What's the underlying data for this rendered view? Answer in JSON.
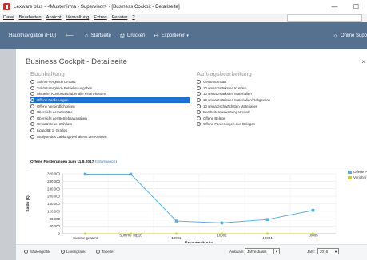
{
  "window": {
    "title": "Lexware plus - <Musterfirma - Supervisor> - [Business Cockpit - Detailseite]",
    "controls": [
      "—",
      "☐"
    ]
  },
  "menu": {
    "items": [
      "Datei",
      "Bearbeiten",
      "Ansicht",
      "Verwaltung",
      "Extras",
      "Fenster",
      "?"
    ]
  },
  "toolbar": {
    "hauptnavigation": "Hauptnavigation (F10)",
    "startseite": "Startseite",
    "drucken": "Drucken",
    "exportieren": "Exportieren",
    "online": "Online Supp"
  },
  "page": {
    "title": "Business Cockpit - Detailseite",
    "close": "×"
  },
  "buchhaltung": {
    "heading": "Buchhaltung",
    "selected_index": 3,
    "items": [
      "Soll/Ist-Vergleich Umsatz",
      "Soll/Ist-Vergleich Betriebsausgaben",
      "Aktueller Kontostand über alle Finanzkonten",
      "Offene Forderungen",
      "Offene Verbindlichkeiten",
      "Übersicht der Umsätze",
      "Übersicht der Betriebsausgaben",
      "Umsatzsteuer Zahllast",
      "Liquidität 1. Grades",
      "Analyse des Zahlungsverhaltens der Kunden"
    ]
  },
  "auftrag": {
    "heading": "Auftragsbearbeitung",
    "items": [
      "Gesamtumsatz",
      "10 umsatzstärksten Kunden",
      "10 umsatzstärksten Materialien",
      "10 umsatzstärksten Materialien/Rohgewinn",
      "10 umsatzschwächsten Materialien",
      "Bearbeiterauswertung Umsatz",
      "Offene Belege",
      "Offene Forderungen aus Belegen"
    ]
  },
  "chart_header": {
    "title": "Offene Forderungen zum 11.8.2017",
    "info": "(Information)"
  },
  "chart_data": {
    "type": "line",
    "ylabel": "Saldo (€)",
    "xlabel": "Personenkonto",
    "ylim": [
      0,
      320000
    ],
    "yticks": [
      0,
      40000,
      80000,
      120000,
      160000,
      200000,
      240000,
      280000,
      320000
    ],
    "ytick_labels": [
      "0",
      "40.000",
      "80.000",
      "120.000",
      "160.000",
      "200.000",
      "240.000",
      "280.000",
      "320.000"
    ],
    "categories": [
      "Summe gesamt",
      "Summe Top10",
      "10001",
      "10002",
      "10004",
      "10005"
    ],
    "grid": true,
    "legend_position": "top-right",
    "series": [
      {
        "name": "Offene Posten (€)",
        "color": "#5aafd6",
        "values": [
          318000,
          318000,
          68000,
          58000,
          76000,
          125000
        ]
      },
      {
        "name": "Vorjahr (€)",
        "color": "#c9cf2b",
        "values": [
          0,
          0,
          0,
          0,
          0,
          0
        ]
      }
    ]
  },
  "bottom": {
    "options": [
      "Säulengrafik",
      "Liniengrafik",
      "Tabelle"
    ],
    "selected_option": 1,
    "auswahl_label": "Auswahl:",
    "auswahl_value": "Jahresbasis",
    "jahr_label": "Jahr:",
    "jahr_value": "2016"
  }
}
